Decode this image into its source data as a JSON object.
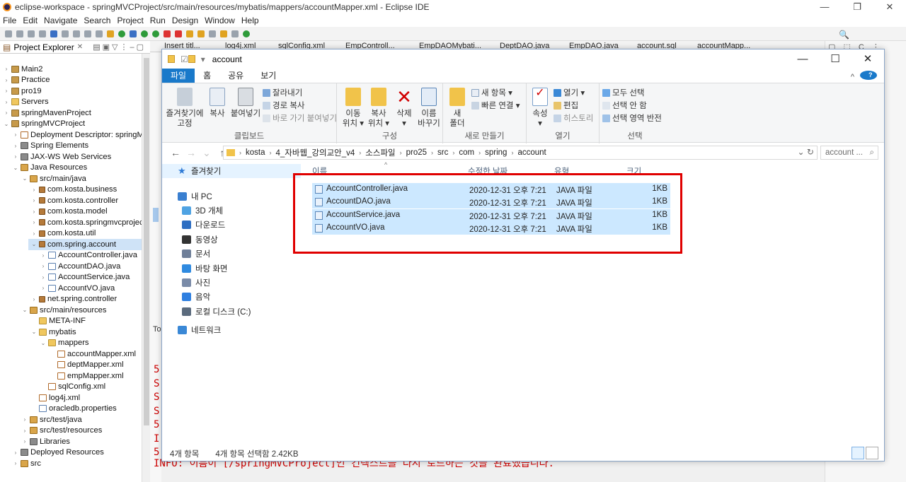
{
  "eclipse": {
    "title": "eclipse-workspace - springMVCProject/src/main/resources/mybatis/mappers/accountMapper.xml - Eclipse IDE",
    "menu": [
      "File",
      "Edit",
      "Navigate",
      "Search",
      "Project",
      "Run",
      "Design",
      "Window",
      "Help"
    ],
    "explorer_title": "Project Explorer",
    "tree": [
      {
        "label": "Main2",
        "depth": 0,
        "icon": "prj",
        "arrow": "›"
      },
      {
        "label": "Practice",
        "depth": 0,
        "icon": "prj",
        "arrow": "›"
      },
      {
        "label": "pro19",
        "depth": 0,
        "icon": "prj",
        "arrow": "›"
      },
      {
        "label": "Servers",
        "depth": 0,
        "icon": "fld",
        "arrow": "›"
      },
      {
        "label": "springMavenProject",
        "depth": 0,
        "icon": "prj",
        "arrow": "›"
      },
      {
        "label": "springMVCProject",
        "depth": 0,
        "icon": "prj",
        "arrow": "⌄"
      },
      {
        "label": "Deployment Descriptor: springMVC",
        "depth": 1,
        "icon": "xml",
        "arrow": "›"
      },
      {
        "label": "Spring Elements",
        "depth": 1,
        "icon": "lib",
        "arrow": "›"
      },
      {
        "label": "JAX-WS Web Services",
        "depth": 1,
        "icon": "lib",
        "arrow": "›"
      },
      {
        "label": "Java Resources",
        "depth": 1,
        "icon": "src",
        "arrow": "⌄"
      },
      {
        "label": "src/main/java",
        "depth": 2,
        "icon": "src",
        "arrow": "⌄"
      },
      {
        "label": "com.kosta.business",
        "depth": 3,
        "icon": "pkg",
        "arrow": "›"
      },
      {
        "label": "com.kosta.controller",
        "depth": 3,
        "icon": "pkg",
        "arrow": "›"
      },
      {
        "label": "com.kosta.model",
        "depth": 3,
        "icon": "pkg",
        "arrow": "›"
      },
      {
        "label": "com.kosta.springmvcproject",
        "depth": 3,
        "icon": "pkg",
        "arrow": "›"
      },
      {
        "label": "com.kosta.util",
        "depth": 3,
        "icon": "pkg",
        "arrow": "›"
      },
      {
        "label": "com.spring.account",
        "depth": 3,
        "icon": "pkg",
        "arrow": "⌄",
        "selected": true
      },
      {
        "label": "AccountController.java",
        "depth": 4,
        "icon": "jav",
        "arrow": "›"
      },
      {
        "label": "AccountDAO.java",
        "depth": 4,
        "icon": "jav",
        "arrow": "›"
      },
      {
        "label": "AccountService.java",
        "depth": 4,
        "icon": "jav",
        "arrow": "›"
      },
      {
        "label": "AccountVO.java",
        "depth": 4,
        "icon": "jav",
        "arrow": "›"
      },
      {
        "label": "net.spring.controller",
        "depth": 3,
        "icon": "pkg",
        "arrow": "›"
      },
      {
        "label": "src/main/resources",
        "depth": 2,
        "icon": "src",
        "arrow": "⌄"
      },
      {
        "label": "META-INF",
        "depth": 3,
        "icon": "fld",
        "arrow": ""
      },
      {
        "label": "mybatis",
        "depth": 3,
        "icon": "fld",
        "arrow": "⌄"
      },
      {
        "label": "mappers",
        "depth": 4,
        "icon": "fld",
        "arrow": "⌄"
      },
      {
        "label": "accountMapper.xml",
        "depth": 5,
        "icon": "xml",
        "arrow": ""
      },
      {
        "label": "deptMapper.xml",
        "depth": 5,
        "icon": "xml",
        "arrow": ""
      },
      {
        "label": "empMapper.xml",
        "depth": 5,
        "icon": "xml",
        "arrow": ""
      },
      {
        "label": "sqlConfig.xml",
        "depth": 4,
        "icon": "xml",
        "arrow": ""
      },
      {
        "label": "log4j.xml",
        "depth": 3,
        "icon": "xml",
        "arrow": ""
      },
      {
        "label": "oracledb.properties",
        "depth": 3,
        "icon": "jav",
        "arrow": ""
      },
      {
        "label": "src/test/java",
        "depth": 2,
        "icon": "src",
        "arrow": "›"
      },
      {
        "label": "src/test/resources",
        "depth": 2,
        "icon": "src",
        "arrow": "›"
      },
      {
        "label": "Libraries",
        "depth": 2,
        "icon": "lib",
        "arrow": "›"
      },
      {
        "label": "Deployed Resources",
        "depth": 1,
        "icon": "lib",
        "arrow": "›"
      },
      {
        "label": "src",
        "depth": 1,
        "icon": "src",
        "arrow": "›"
      }
    ],
    "editor_tabs": [
      "Insert titl...",
      "log4j.xml",
      "sqlConfig.xml",
      "EmpControll...",
      "EmpDAOMybati...",
      "DeptDAO.java",
      "EmpDAO.java",
      "account.sql",
      "accountMapp..."
    ],
    "console_to": "To",
    "console_lines": [
      "5",
      "S",
      "S",
      "S",
      "5",
      "I",
      "5"
    ],
    "console_last": "INFO: 이름이 [/springMVCProject]인 컨텍스트를 다시 로드하는 것을 완료했습니다."
  },
  "explorer": {
    "title": "account",
    "tabs": [
      "파일",
      "홈",
      "공유",
      "보기"
    ],
    "ribbon": {
      "clipboard": {
        "pin": "즐겨찾기에\n고정",
        "copy": "복사",
        "paste": "붙여넣기",
        "cut": "잘라내기",
        "copy_path": "경로 복사",
        "paste_shortcut": "바로 가기 붙여넣기",
        "label": "클립보드"
      },
      "organize": {
        "move": "이동\n위치 ▾",
        "copyto": "복사\n위치 ▾",
        "delete": "삭제\n▾",
        "rename": "이름\n바꾸기",
        "label": "구성"
      },
      "new": {
        "new_folder": "새\n폴더",
        "new_item": "새 항목 ▾",
        "easy_access": "빠른 연결 ▾",
        "label": "새로 만들기"
      },
      "open": {
        "properties": "속성\n▾",
        "open": "열기 ▾",
        "edit": "편집",
        "history": "히스토리",
        "label": "열기"
      },
      "select": {
        "select_all": "모두 선택",
        "select_none": "선택 안 함",
        "invert": "선택 영역 반전",
        "label": "선택"
      }
    },
    "path": [
      "kosta",
      "4_자바웹_강의교안_v4",
      "소스파일",
      "pro25",
      "src",
      "com",
      "spring",
      "account"
    ],
    "search_placeholder": "account ...",
    "nav": [
      {
        "label": "즐겨찾기",
        "color": "#2f7bd6",
        "indent": 0,
        "selected": true
      },
      {
        "label": "내 PC",
        "color": "#3a7fd0",
        "indent": 0
      },
      {
        "label": "3D 개체",
        "color": "#4fa3e3",
        "indent": 1
      },
      {
        "label": "다운로드",
        "color": "#2d6ec2",
        "indent": 1
      },
      {
        "label": "동영상",
        "color": "#333333",
        "indent": 1
      },
      {
        "label": "문서",
        "color": "#6f7f99",
        "indent": 1
      },
      {
        "label": "바탕 화면",
        "color": "#2f8ae0",
        "indent": 1
      },
      {
        "label": "사진",
        "color": "#7a8ba8",
        "indent": 1
      },
      {
        "label": "음악",
        "color": "#2e7fe0",
        "indent": 1
      },
      {
        "label": "로컬 디스크 (C:)",
        "color": "#5b6b7d",
        "indent": 1
      },
      {
        "label": "네트워크",
        "color": "#3a88d6",
        "indent": 0
      }
    ],
    "columns": [
      "이름",
      "수정한 날짜",
      "유형",
      "크기"
    ],
    "files": [
      {
        "name": "AccountController.java",
        "date": "2020-12-31 오후 7:21",
        "type": "JAVA 파일",
        "size": "1KB"
      },
      {
        "name": "AccountDAO.java",
        "date": "2020-12-31 오후 7:21",
        "type": "JAVA 파일",
        "size": "1KB"
      },
      {
        "name": "AccountService.java",
        "date": "2020-12-31 오후 7:21",
        "type": "JAVA 파일",
        "size": "1KB"
      },
      {
        "name": "AccountVO.java",
        "date": "2020-12-31 오후 7:21",
        "type": "JAVA 파일",
        "size": "1KB"
      }
    ],
    "status_count": "4개 항목",
    "status_selected": "4개 항목 선택함 2.42KB"
  }
}
